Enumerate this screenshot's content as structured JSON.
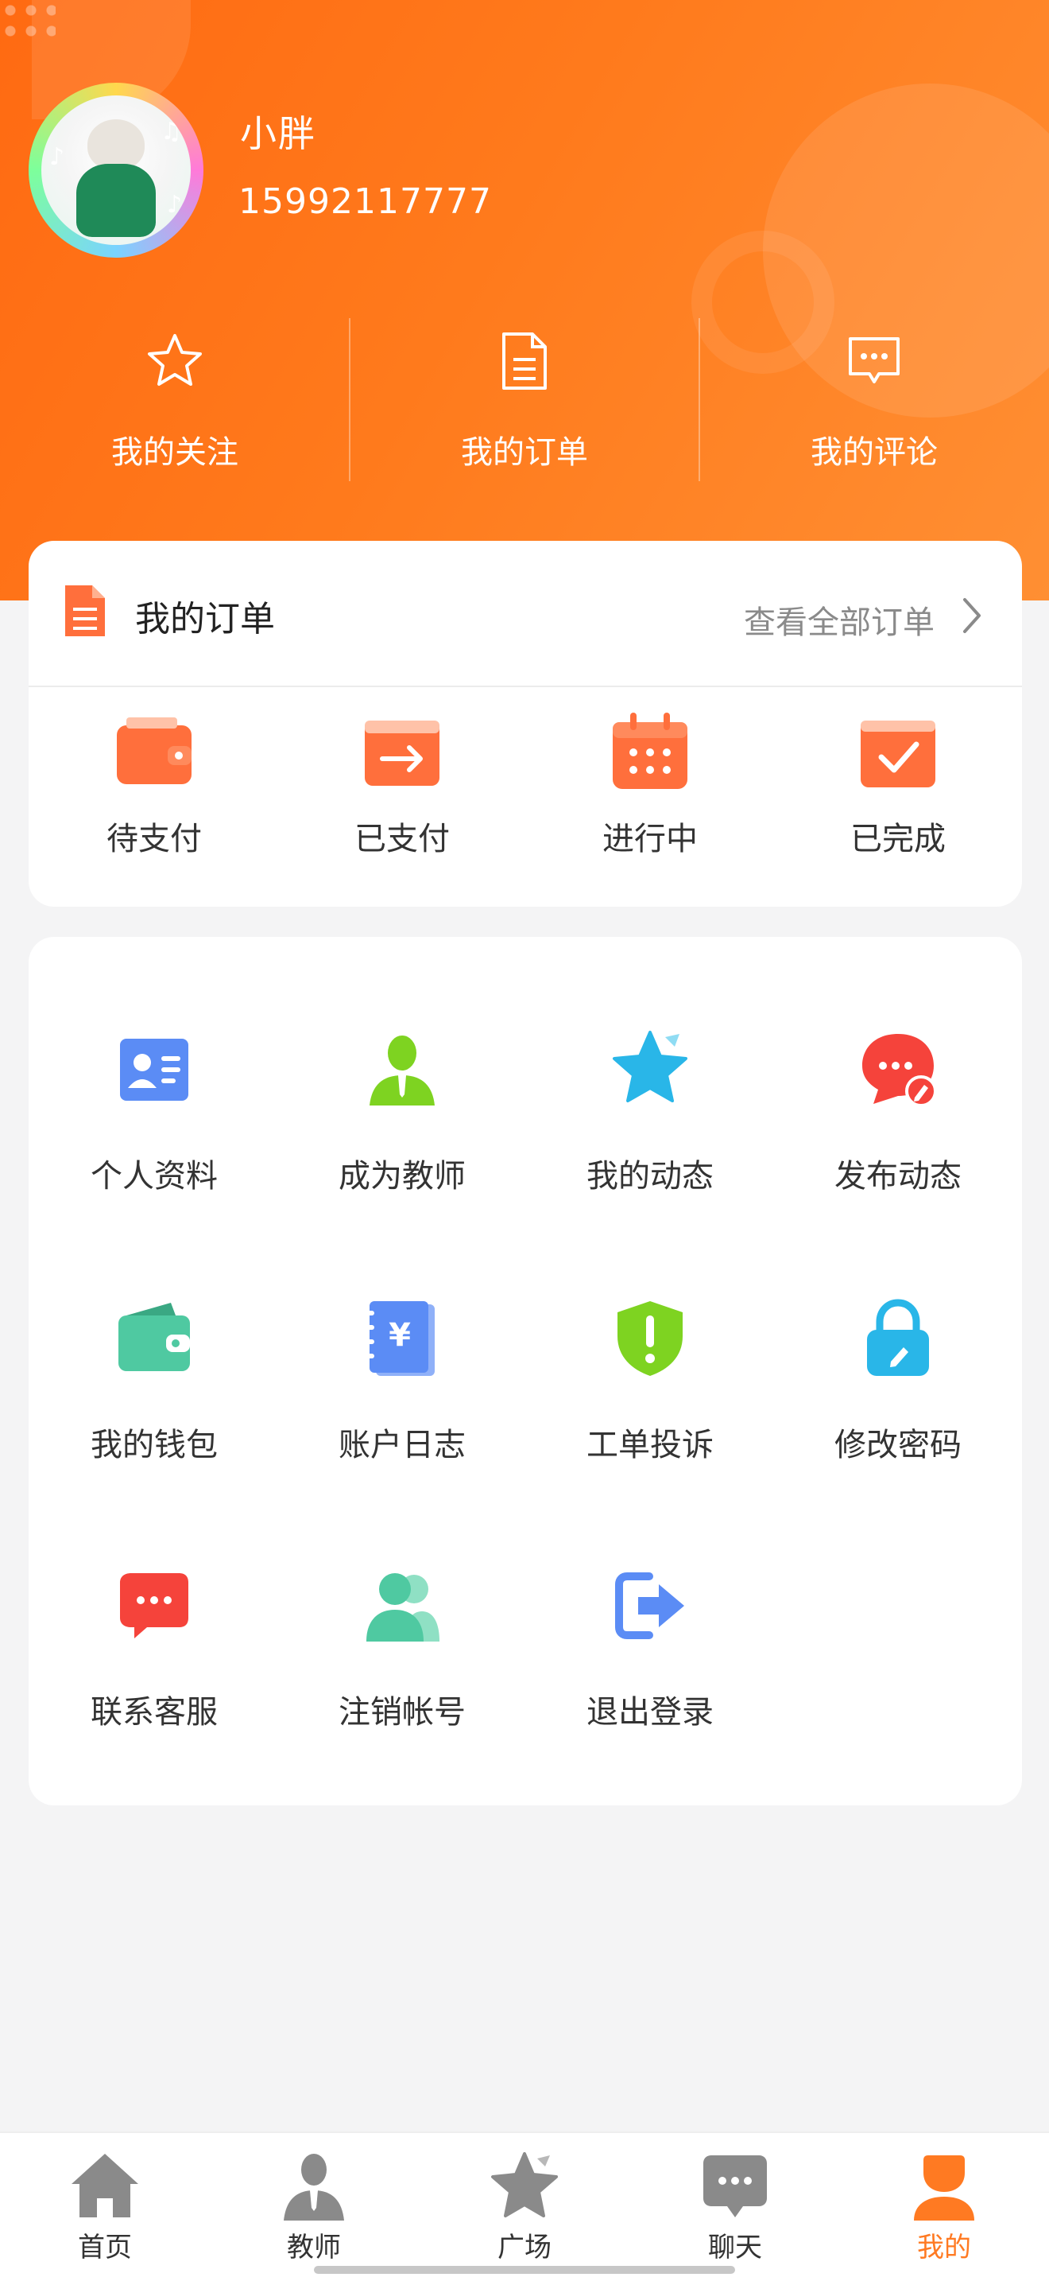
{
  "profile": {
    "name": "小胖",
    "phone": "15992117777"
  },
  "quick_actions": [
    {
      "label": "我的关注",
      "icon": "star-outline-icon"
    },
    {
      "label": "我的订单",
      "icon": "document-icon"
    },
    {
      "label": "我的评论",
      "icon": "comment-icon"
    }
  ],
  "orders": {
    "title": "我的订单",
    "view_all": "查看全部订单",
    "statuses": [
      {
        "label": "待支付",
        "icon": "wallet-icon"
      },
      {
        "label": "已支付",
        "icon": "arrow-box-icon"
      },
      {
        "label": "进行中",
        "icon": "calendar-icon"
      },
      {
        "label": "已完成",
        "icon": "check-box-icon"
      }
    ]
  },
  "menu": [
    {
      "label": "个人资料",
      "icon": "id-card-icon",
      "color": "#5b8cf5"
    },
    {
      "label": "成为教师",
      "icon": "teacher-icon",
      "color": "#7ed321"
    },
    {
      "label": "我的动态",
      "icon": "star-icon",
      "color": "#29b6e8"
    },
    {
      "label": "发布动态",
      "icon": "chat-edit-icon",
      "color": "#f5433b"
    },
    {
      "label": "我的钱包",
      "icon": "wallet-icon",
      "color": "#4fc9a1"
    },
    {
      "label": "账户日志",
      "icon": "ledger-icon",
      "color": "#5b8cf5"
    },
    {
      "label": "工单投诉",
      "icon": "shield-alert-icon",
      "color": "#7ed321"
    },
    {
      "label": "修改密码",
      "icon": "lock-icon",
      "color": "#29b6e8"
    },
    {
      "label": "联系客服",
      "icon": "chat-bubble-icon",
      "color": "#f5433b"
    },
    {
      "label": "注销帐号",
      "icon": "users-icon",
      "color": "#4fc9a1"
    },
    {
      "label": "退出登录",
      "icon": "logout-icon",
      "color": "#5b8cf5"
    }
  ],
  "tabs": [
    {
      "label": "首页",
      "icon": "home-icon"
    },
    {
      "label": "教师",
      "icon": "teacher-icon"
    },
    {
      "label": "广场",
      "icon": "star-icon"
    },
    {
      "label": "聊天",
      "icon": "chat-icon"
    },
    {
      "label": "我的",
      "icon": "profile-icon",
      "active": true
    }
  ],
  "colors": {
    "accent": "#ff7a22",
    "icon_orange": "#ff6f3c",
    "tab_inactive": "#8a8a8a"
  }
}
